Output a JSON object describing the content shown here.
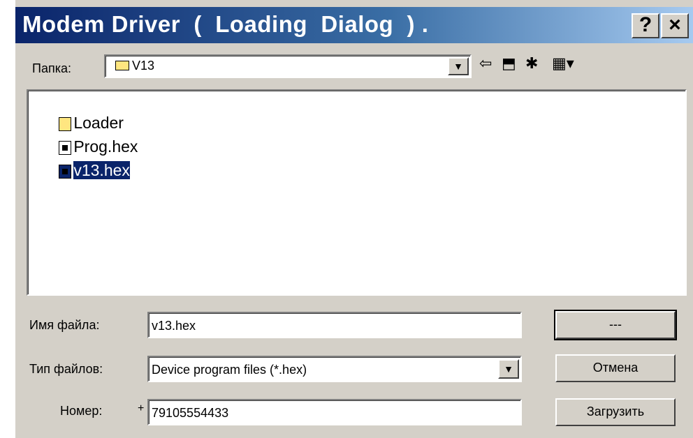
{
  "window": {
    "title": "Modem Driver  (  Loading  Dialog  ) .",
    "help_label": "?",
    "close_label": "×"
  },
  "folder": {
    "label": "Папка:",
    "value": "V13",
    "dropdown_glyph": "▼"
  },
  "toolbar": {
    "back_icon": "⇦",
    "up_folder_icon": "⬒",
    "new_folder_icon": "✱",
    "view_menu_icon": "▦▾"
  },
  "files": {
    "items": [
      {
        "name": "Loader",
        "icon": "folder-icon"
      },
      {
        "name": "Prog.hex",
        "icon": "hex-file-icon"
      },
      {
        "name": "v13.hex",
        "icon": "hex-file-icon",
        "selected": true
      }
    ]
  },
  "form": {
    "filename_label": "Имя файла:",
    "filename_value": "v13.hex",
    "filetype_label": "Тип файлов:",
    "filetype_value": "Device program files (*.hex)",
    "filetype_dropdown_glyph": "▼",
    "number_label": "Номер:",
    "number_prefix": "+",
    "number_value": "79105554433"
  },
  "buttons": {
    "ok_label": "---",
    "cancel_label": "Отмена",
    "load_label": "Загрузить"
  },
  "colors": {
    "title_start": "#0a246a",
    "title_end": "#a6caf0",
    "dialog_bg": "#d4d0c8",
    "selection": "#0a246a"
  }
}
